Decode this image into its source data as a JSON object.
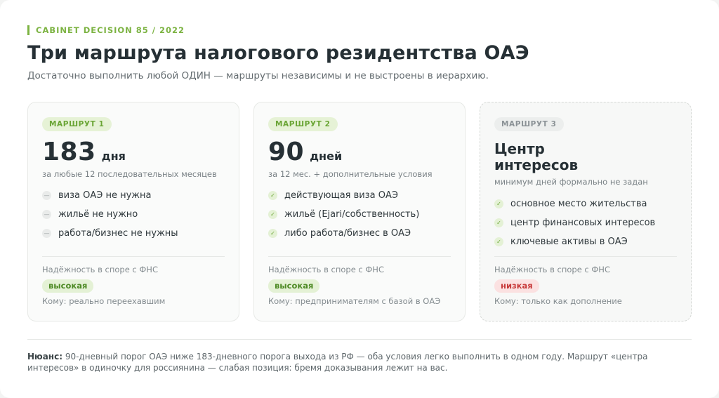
{
  "header": {
    "eyebrow": "CABINET DECISION 85 / 2022",
    "title": "Три маршрута налогового резидентства ОАЭ",
    "subtitle": "Достаточно выполнить любой ОДИН — маршруты независимы и не выстроены в иерархию."
  },
  "colors": {
    "accent": "#7cb342",
    "high_bg": "#e4f1d5",
    "low_bg": "#fbe1e1",
    "low_text": "#c73a3a"
  },
  "routes": [
    {
      "badge": "МАРШРУТ 1",
      "number": "183",
      "unit": "дня",
      "caption": "за любые 12 последовательных месяцев",
      "items": [
        {
          "marker": "dash-icon",
          "text": "виза ОАЭ не нужна"
        },
        {
          "marker": "dash-icon",
          "text": "жильё не нужно"
        },
        {
          "marker": "dash-icon",
          "text": "работа/бизнес не нужны"
        }
      ],
      "reliability_label": "Надёжность в споре с ФНС",
      "reliability": "высокая",
      "who": "Кому: реально переехавшим"
    },
    {
      "badge": "МАРШРУТ 2",
      "number": "90",
      "unit": "дней",
      "caption": "за 12 мес. + дополнительные условия",
      "items": [
        {
          "marker": "check-icon",
          "text": "действующая виза ОАЭ"
        },
        {
          "marker": "check-icon",
          "text": "жильё (Ejari/собственность)"
        },
        {
          "marker": "check-icon",
          "text": "либо работа/бизнес в ОАЭ"
        }
      ],
      "reliability_label": "Надёжность в споре с ФНС",
      "reliability": "высокая",
      "who": "Кому: предпринимателям с базой в ОАЭ"
    },
    {
      "badge": "МАРШРУТ 3",
      "title_line1": "Центр",
      "title_line2": "интересов",
      "caption": "минимум дней формально не задан",
      "items": [
        {
          "marker": "check-icon",
          "text": "основное место жительства"
        },
        {
          "marker": "check-icon",
          "text": "центр финансовых интересов"
        },
        {
          "marker": "check-icon",
          "text": "ключевые активы в ОАЭ"
        }
      ],
      "reliability_label": "Надёжность в споре с ФНС",
      "reliability": "низкая",
      "who": "Кому: только как дополнение"
    }
  ],
  "footer": {
    "label": "Нюанс:",
    "text": " 90-дневный порог ОАЭ ниже 183-дневного порога выхода из РФ — оба условия легко выполнить в одном году. Маршрут «центра интересов» в одиночку для россиянина — слабая позиция: бремя доказывания лежит на вас."
  }
}
